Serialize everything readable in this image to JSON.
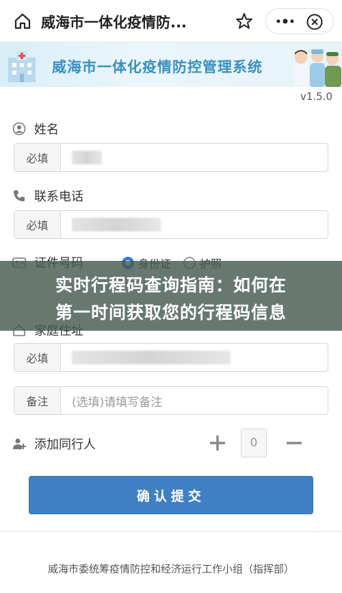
{
  "header": {
    "title": "威海市一体化疫情防...",
    "icons": [
      "home-icon",
      "star-icon",
      "more-icon",
      "close-icon"
    ]
  },
  "banner": {
    "title": "威海市一体化疫情防控管理系统"
  },
  "version": "v1.5.0",
  "form": {
    "name": {
      "label": "姓名",
      "addon": "必填"
    },
    "phone": {
      "label": "联系电话",
      "addon": "必填"
    },
    "id_number": {
      "label": "证件号码",
      "options": [
        "身份证",
        "护照"
      ],
      "selected": "身份证"
    },
    "address": {
      "label": "家庭住址",
      "addon": "必填"
    },
    "remark": {
      "addon": "备注",
      "placeholder": "(选填)请填写备注"
    },
    "companion": {
      "label": "添加同行人",
      "count": "0"
    },
    "submit_label": "确认提交"
  },
  "overlay": {
    "line1": "实时行程码查询指南：如何在",
    "line2": "第一时间获取您的行程码信息"
  },
  "footer": "威海市委统筹疫情防控和经济运行工作小组（指挥部）",
  "colors": {
    "primary": "#3f7fc3",
    "banner_text": "#3a8fc0",
    "radio_selected": "#2d7fd8",
    "overlay": "#465a50"
  }
}
